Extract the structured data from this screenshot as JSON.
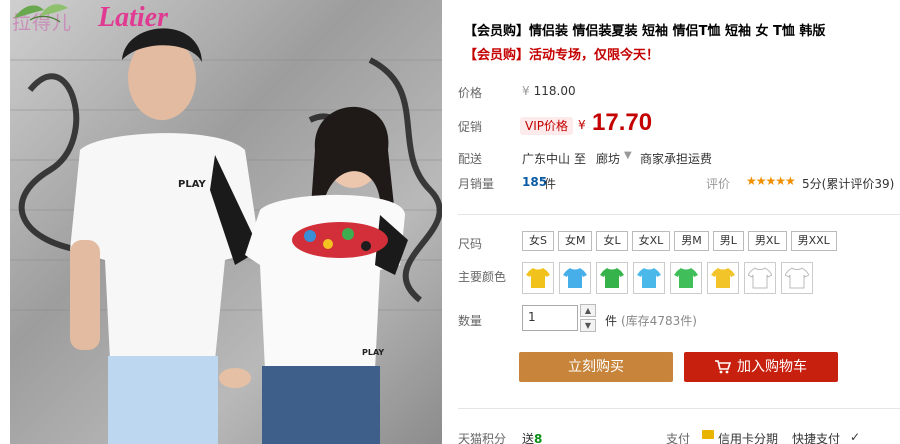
{
  "brand": {
    "name_cn": "拉得儿",
    "name_en": "Latier"
  },
  "product": {
    "title": "【会员购】情侣装 情侣装夏装 短袖 情侣T恤 短袖 女 T恤 韩版",
    "promo": "【会员购】活动专场，仅限今天！"
  },
  "price": {
    "label": "价格",
    "currency": "¥",
    "original": "118.00",
    "promo_label": "促销",
    "vip_label": "VIP价格",
    "current": "17.70"
  },
  "shipping": {
    "label": "配送",
    "from": "广东中山",
    "to_word": "至",
    "to": "廊坊",
    "note": "商家承担运费"
  },
  "sales": {
    "label": "月销量",
    "count": "185",
    "unit": "件",
    "review_label": "评价",
    "stars": "★★★★★",
    "rating": "5分(累计评价39)"
  },
  "size": {
    "label": "尺码",
    "options": [
      "女S",
      "女M",
      "女L",
      "女XL",
      "男M",
      "男L",
      "男XL",
      "男XXL"
    ]
  },
  "color": {
    "label": "主要颜色",
    "swatches": [
      "#f1c21b",
      "#46aee8",
      "#36b34a",
      "#4bb8ea",
      "#3fbe5a",
      "#f2c42a",
      "#ffffff",
      "#ffffff"
    ]
  },
  "quantity": {
    "label": "数量",
    "value": "1",
    "unit": "件",
    "stock": "(库存4783件)"
  },
  "buttons": {
    "buy": "立刻购买",
    "cart": "加入购物车"
  },
  "footer": {
    "points_label": "天猫积分",
    "points_prefix": "送",
    "points_value": "8",
    "pay_label": "支付",
    "pay_card": "信用卡分期",
    "pay_fast": "快捷支付"
  }
}
